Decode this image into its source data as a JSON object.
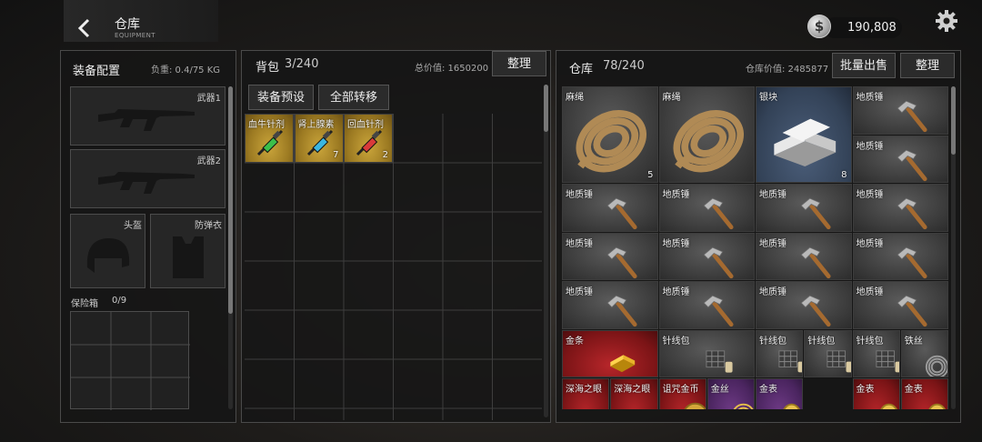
{
  "header": {
    "title": "仓库",
    "subtitle": "EQUIPMENT",
    "currency": "190,808",
    "currency_icon": "$"
  },
  "equipment": {
    "title": "装备配置",
    "weight": "负重: 0.4/75 KG",
    "slots": {
      "weapon1": "武器1",
      "weapon2": "武器2",
      "helmet": "头盔",
      "armor": "防弹衣"
    },
    "safebox_label": "保险箱",
    "safebox_count": "0/9"
  },
  "backpack": {
    "title": "背包",
    "count": "3/240",
    "total_value": "总价值: 1650200",
    "sort_btn": "整理",
    "preset_btn": "装备预设",
    "transfer_btn": "全部转移",
    "items": [
      {
        "name": "血牛针剂",
        "count": "",
        "color": "#3bbf4a"
      },
      {
        "name": "肾上腺素",
        "count": "7",
        "color": "#3bb6e0"
      },
      {
        "name": "回血针剂",
        "count": "2",
        "color": "#d93a3a"
      }
    ]
  },
  "warehouse": {
    "title": "仓库",
    "count": "78/240",
    "value": "仓库价值: 2485877",
    "bulk_sell_btn": "批量出售",
    "sort_btn": "整理",
    "items": [
      {
        "name": "麻绳",
        "count": "5",
        "icon": "rope-icon",
        "rarity": "gray"
      },
      {
        "name": "麻绳",
        "count": "",
        "icon": "rope-icon",
        "rarity": "gray"
      },
      {
        "name": "银块",
        "count": "8",
        "icon": "silver-bar-icon",
        "rarity": "blue"
      },
      {
        "name": "地质锤",
        "count": "",
        "icon": "hammer-icon",
        "rarity": "gray"
      },
      {
        "name": "地质锤",
        "count": "",
        "icon": "hammer-icon",
        "rarity": "gray"
      },
      {
        "name": "地质锤",
        "count": "",
        "icon": "hammer-icon",
        "rarity": "gray"
      },
      {
        "name": "地质锤",
        "count": "",
        "icon": "hammer-icon",
        "rarity": "gray"
      },
      {
        "name": "地质锤",
        "count": "",
        "icon": "hammer-icon",
        "rarity": "gray"
      },
      {
        "name": "地质锤",
        "count": "",
        "icon": "hammer-icon",
        "rarity": "gray"
      },
      {
        "name": "地质锤",
        "count": "",
        "icon": "hammer-icon",
        "rarity": "gray"
      },
      {
        "name": "地质锤",
        "count": "",
        "icon": "hammer-icon",
        "rarity": "gray"
      },
      {
        "name": "地质锤",
        "count": "",
        "icon": "hammer-icon",
        "rarity": "gray"
      },
      {
        "name": "地质锤",
        "count": "",
        "icon": "hammer-icon",
        "rarity": "gray"
      },
      {
        "name": "地质锤",
        "count": "",
        "icon": "hammer-icon",
        "rarity": "gray"
      },
      {
        "name": "地质锤",
        "count": "",
        "icon": "hammer-icon",
        "rarity": "gray"
      },
      {
        "name": "地质锤",
        "count": "",
        "icon": "hammer-icon",
        "rarity": "gray"
      },
      {
        "name": "地质锤",
        "count": "",
        "icon": "hammer-icon",
        "rarity": "gray"
      },
      {
        "name": "金条",
        "count": "",
        "icon": "gold-bar-icon",
        "rarity": "red"
      },
      {
        "name": "针线包",
        "count": "",
        "icon": "sewing-kit-icon",
        "rarity": "gray"
      },
      {
        "name": "针线包",
        "count": "",
        "icon": "sewing-kit-icon",
        "rarity": "gray"
      },
      {
        "name": "针线包",
        "count": "",
        "icon": "sewing-kit-icon",
        "rarity": "gray"
      },
      {
        "name": "针线包",
        "count": "",
        "icon": "sewing-kit-icon",
        "rarity": "gray"
      },
      {
        "name": "铁丝",
        "count": "",
        "icon": "wire-icon",
        "rarity": "gray"
      },
      {
        "name": "深海之眼",
        "count": "",
        "icon": "pearl-shell-icon",
        "rarity": "red"
      },
      {
        "name": "深海之眼",
        "count": "",
        "icon": "pearl-shell-icon",
        "rarity": "red"
      },
      {
        "name": "诅咒金币",
        "count": "",
        "icon": "cursed-coin-icon",
        "rarity": "red"
      },
      {
        "name": "金丝",
        "count": "",
        "icon": "gold-wire-icon",
        "rarity": "purple"
      },
      {
        "name": "金表",
        "count": "",
        "icon": "gold-watch-icon",
        "rarity": "purple"
      },
      {
        "name": "金表",
        "count": "",
        "icon": "gold-watch-icon",
        "rarity": "red"
      },
      {
        "name": "金表",
        "count": "",
        "icon": "gold-watch-icon",
        "rarity": "red"
      }
    ]
  }
}
